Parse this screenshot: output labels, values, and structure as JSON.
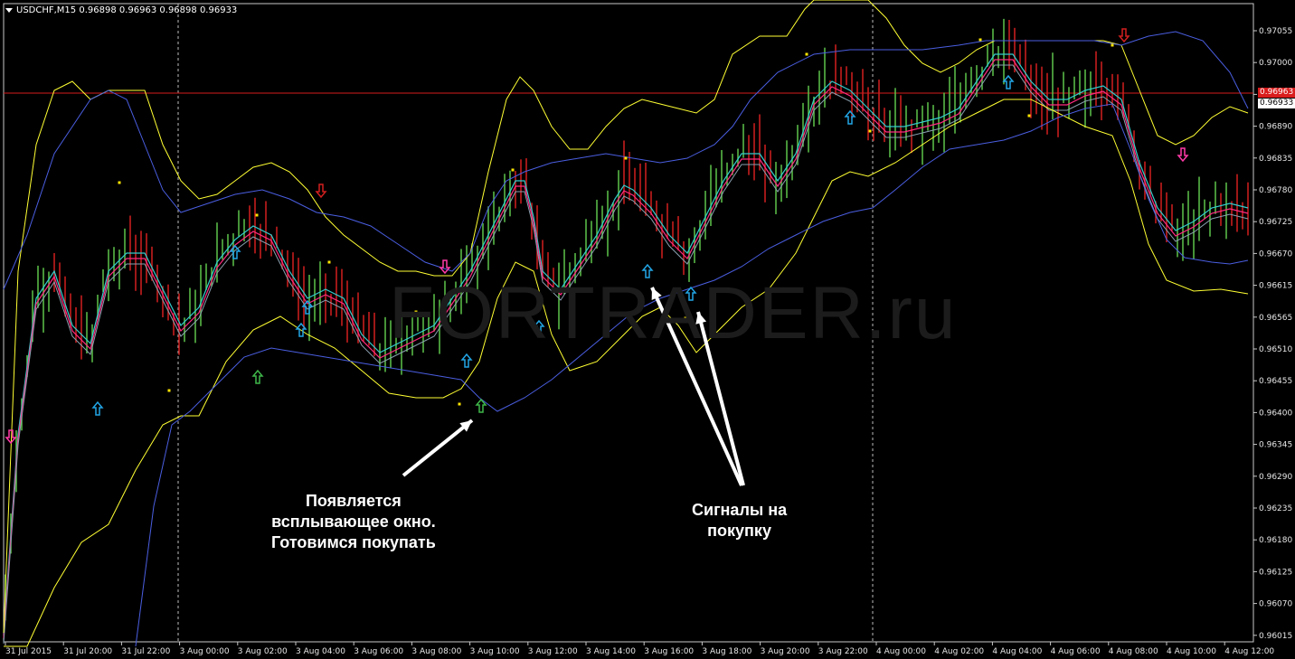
{
  "header": {
    "symbol": "USDCHF,M15",
    "ohlc": "0.96898 0.96963 0.96898 0.96933"
  },
  "watermark": "FORTRADER.ru",
  "annotations": {
    "popup": [
      "Появляется",
      "всплывающее окно.",
      "Готовимся покупать"
    ],
    "signals": [
      "Сигналы на",
      "покупку"
    ]
  },
  "price_axis": {
    "labels": [
      "0.97055",
      "0.97000",
      "0.96945",
      "0.96890",
      "0.96835",
      "0.96780",
      "0.96725",
      "0.96670",
      "0.96615",
      "0.96565",
      "0.96510",
      "0.96455",
      "0.96400",
      "0.96345",
      "0.96290",
      "0.96235",
      "0.96180",
      "0.96125",
      "0.96070",
      "0.96015"
    ],
    "hline_label": "0.96963",
    "current_label": "0.96933"
  },
  "time_axis": {
    "labels": [
      "31 Jul 2015",
      "31 Jul 20:00",
      "31 Jul 22:00",
      "3 Aug 00:00",
      "3 Aug 02:00",
      "3 Aug 04:00",
      "3 Aug 06:00",
      "3 Aug 08:00",
      "3 Aug 10:00",
      "3 Aug 12:00",
      "3 Aug 14:00",
      "3 Aug 16:00",
      "3 Aug 18:00",
      "3 Aug 20:00",
      "3 Aug 22:00",
      "4 Aug 00:00",
      "4 Aug 02:00",
      "4 Aug 04:00",
      "4 Aug 06:00",
      "4 Aug 08:00",
      "4 Aug 10:00",
      "4 Aug 12:00"
    ]
  },
  "colors": {
    "background": "#000000",
    "bull_bar": "#5ec44a",
    "bear_bar": "#d21f1f",
    "upper_bb": "#ffff33",
    "blue_env": "#4a5ee0",
    "hline": "#d91c1c",
    "buy_arrow": "#22a6e6",
    "sell_arrow": "#ff3aa8"
  }
}
